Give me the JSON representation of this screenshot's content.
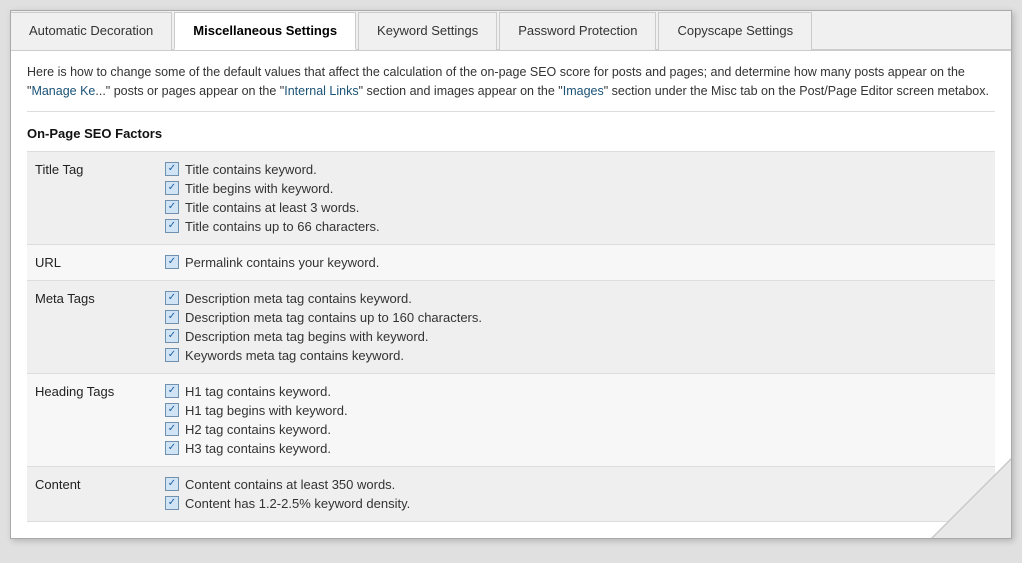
{
  "tabs": [
    {
      "id": "automatic-decoration",
      "label": "Automatic Decoration",
      "active": false
    },
    {
      "id": "miscellaneous-settings",
      "label": "Miscellaneous Settings",
      "active": true
    },
    {
      "id": "keyword-settings",
      "label": "Keyword Settings",
      "active": false
    },
    {
      "id": "password-protection",
      "label": "Password Protection",
      "active": false
    },
    {
      "id": "copyscape-settings",
      "label": "Copyscape Settings",
      "active": false
    }
  ],
  "description": "Here is how to change some of the default values that affect the calculation of the on-page SEO score for posts and pages; and determine how many posts appear on the \"Manage Ke... posts or pages appear on the \"Internal Links\" section and images appear on the \"Images\" section under the Misc tab on the Post/Page Editor screen metabox.",
  "section_title": "On-Page SEO Factors",
  "rows": [
    {
      "label": "Title Tag",
      "checks": [
        "Title contains keyword.",
        "Title begins with keyword.",
        "Title contains at least 3 words.",
        "Title contains up to 66 characters."
      ]
    },
    {
      "label": "URL",
      "checks": [
        "Permalink contains your keyword."
      ]
    },
    {
      "label": "Meta Tags",
      "checks": [
        "Description meta tag contains keyword.",
        "Description meta tag contains up to 160 characters.",
        "Description meta tag begins with keyword.",
        "Keywords meta tag contains keyword."
      ]
    },
    {
      "label": "Heading Tags",
      "checks": [
        "H1 tag contains keyword.",
        "H1 tag begins with keyword.",
        "H2 tag contains keyword.",
        "H3 tag contains keyword."
      ]
    },
    {
      "label": "Content",
      "checks": [
        "Content contains at least 350 words.",
        "Content has 1.2-2.5% keyword density."
      ]
    }
  ]
}
